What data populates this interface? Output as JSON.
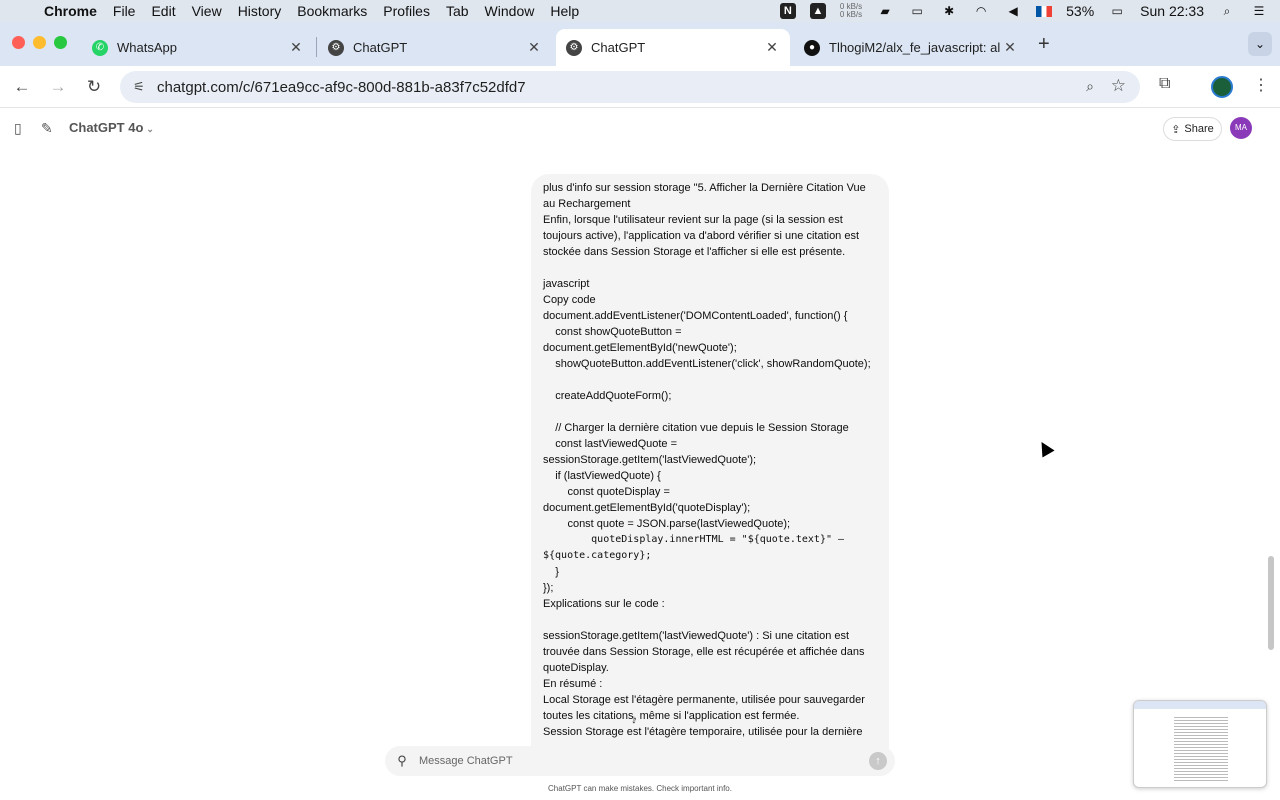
{
  "menubar": {
    "app": "Chrome",
    "items": [
      "File",
      "Edit",
      "View",
      "History",
      "Bookmarks",
      "Profiles",
      "Tab",
      "Window",
      "Help"
    ],
    "net_up": "0 kB/s",
    "net_down": "0 kB/s",
    "battery": "53%",
    "clock": "Sun 22:33",
    "notion_icon": "N"
  },
  "tabs": [
    {
      "title": "WhatsApp",
      "icon": "whatsapp-icon",
      "color": "#25d366"
    },
    {
      "title": "ChatGPT",
      "icon": "openai-icon",
      "color": "#444444"
    },
    {
      "title": "ChatGPT",
      "icon": "openai-icon",
      "color": "#444444"
    },
    {
      "title": "TlhogiM2/alx_fe_javascript: al",
      "icon": "github-icon",
      "color": "#111111"
    }
  ],
  "address": {
    "url": "chatgpt.com/c/671ea9cc-af9c-800d-881b-a83f7c52dfd7"
  },
  "header": {
    "model": "ChatGPT 4o",
    "share_label": "Share",
    "avatar_initials": "MA"
  },
  "message": {
    "lines": [
      {
        "text": "plus d'info sur session storage \"5. Afficher la Dernière Citation Vue"
      },
      {
        "text": "au Rechargement"
      },
      {
        "text": "Enfin, lorsque l'utilisateur revient sur la page (si la session est"
      },
      {
        "text": "toujours active), l'application va d'abord vérifier si une citation est"
      },
      {
        "text": "stockée dans Session Storage et l'afficher si elle est présente."
      },
      {
        "text": ""
      },
      {
        "text": "javascript"
      },
      {
        "text": "Copy code"
      },
      {
        "text": "document.addEventListener('DOMContentLoaded', function() {"
      },
      {
        "text": "    const showQuoteButton ="
      },
      {
        "text": "document.getElementById('newQuote');"
      },
      {
        "text": "    showQuoteButton.addEventListener('click', showRandomQuote);"
      },
      {
        "text": ""
      },
      {
        "text": "    createAddQuoteForm();"
      },
      {
        "text": ""
      },
      {
        "text": "    // Charger la dernière citation vue depuis le Session Storage"
      },
      {
        "text": "    const lastViewedQuote ="
      },
      {
        "text": "sessionStorage.getItem('lastViewedQuote');"
      },
      {
        "text": "    if (lastViewedQuote) {"
      },
      {
        "text": "        const quoteDisplay ="
      },
      {
        "text": "document.getElementById('quoteDisplay');"
      },
      {
        "text": "        const quote = JSON.parse(lastViewedQuote);"
      },
      {
        "text": "        quoteDisplay.innerHTML = \"${quote.text}\" —",
        "mono": true
      },
      {
        "text": "${quote.category};",
        "mono": true
      },
      {
        "text": "    }"
      },
      {
        "text": "});"
      },
      {
        "text": "Explications sur le code :"
      },
      {
        "text": ""
      },
      {
        "text": "sessionStorage.getItem('lastViewedQuote') : Si une citation est"
      },
      {
        "text": "trouvée dans Session Storage, elle est récupérée et affichée dans"
      },
      {
        "text": "quoteDisplay."
      },
      {
        "text": "En résumé :"
      },
      {
        "text": "Local Storage est l'étagère permanente, utilisée pour sauvegarder"
      },
      {
        "text": "toutes les citations, même si l'application est fermée."
      },
      {
        "text": "Session Storage est l'étagère temporaire, utilisée pour la dernière"
      }
    ]
  },
  "composer": {
    "placeholder": "Message ChatGPT",
    "disclaimer": "ChatGPT can make mistakes. Check important info."
  }
}
